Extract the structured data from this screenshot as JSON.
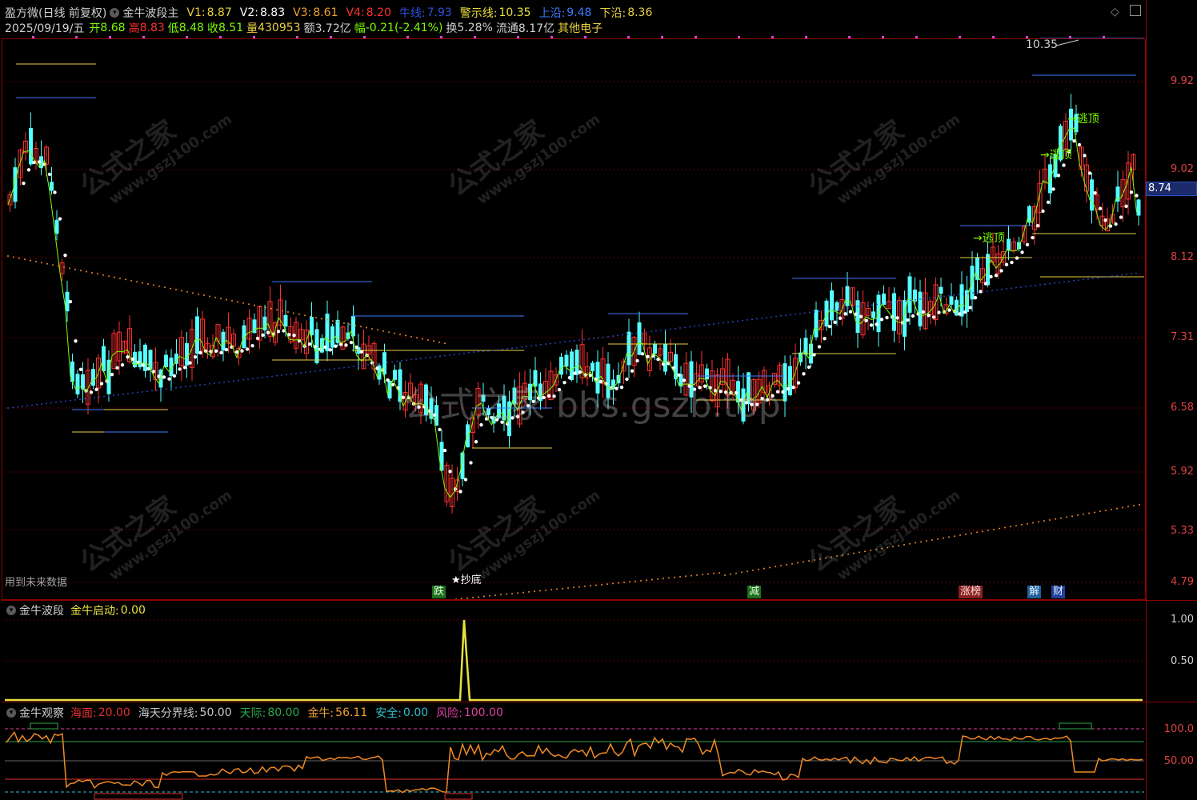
{
  "header": {
    "app_title": "盈方微(日线 前复权)",
    "indicator_name": "金牛波段主",
    "v1": {
      "label": "V1:",
      "value": "8.87"
    },
    "v2": {
      "label": "V2:",
      "value": "8.83"
    },
    "v3": {
      "label": "V3:",
      "value": "8.61"
    },
    "v4": {
      "label": "V4:",
      "value": "8.20"
    },
    "trend": {
      "label": "牛线:",
      "value": "7.93"
    },
    "warn": {
      "label": "警示线:",
      "value": "10.35"
    },
    "upper": {
      "label": "上沿:",
      "value": "9.48"
    },
    "lower": {
      "label": "下沿:",
      "value": "8.36"
    },
    "date": "2025/09/19/五",
    "open": {
      "label": "开",
      "value": "8.68"
    },
    "high": {
      "label": "高",
      "value": "8.83"
    },
    "low": {
      "label": "低",
      "value": "8.48"
    },
    "close": {
      "label": "收",
      "value": "8.51"
    },
    "volume": {
      "label": "量",
      "value": "430953"
    },
    "amount": {
      "label": "额",
      "value": "3.72亿"
    },
    "change": {
      "label": "幅",
      "value": "-0.21(-2.41%)"
    },
    "turnover": {
      "label": "换",
      "value": "5.28%"
    },
    "float_cap": {
      "label": "流通",
      "value": "8.17亿"
    },
    "sector": "其他电子"
  },
  "main_panel": {
    "price_axis": [
      "9.92",
      "9.02",
      "8.12",
      "7.31",
      "6.58",
      "5.92",
      "5.33",
      "4.79"
    ],
    "current_price_tag": "8.74",
    "peak_label": "10.35",
    "bottom_label": "抄底",
    "escape_labels": [
      "逃顶",
      "逃顶",
      "逃顶"
    ],
    "future_note": "用到未来数据",
    "event_tags": [
      {
        "text": "跌",
        "color": "#2e8b2e"
      },
      {
        "text": "减",
        "color": "#2e8b2e"
      },
      {
        "text": "涨榜",
        "color": "#b03030"
      },
      {
        "text": "解",
        "color": "#2a6fa8"
      },
      {
        "text": "财",
        "color": "#2a4fa8"
      }
    ]
  },
  "sub_panel_1": {
    "title": "金牛波段",
    "field": {
      "label": "金牛启动:",
      "value": "0.00"
    },
    "axis": [
      "1.00",
      "0.50"
    ]
  },
  "sub_panel_2": {
    "title": "金牛观察",
    "fields": [
      {
        "label": "海面:",
        "value": "20.00",
        "color": "#e03030"
      },
      {
        "label": "海天分界线:",
        "value": "50.00",
        "color": "#c8c8c8"
      },
      {
        "label": "天际:",
        "value": "80.00",
        "color": "#2aa84a"
      },
      {
        "label": "金牛:",
        "value": "56.11",
        "color": "#f0a030"
      },
      {
        "label": "安全:",
        "value": "0.00",
        "color": "#30c0d0"
      },
      {
        "label": "风险:",
        "value": "100.00",
        "color": "#e040a0"
      }
    ],
    "axis": [
      "100.0",
      "50.00"
    ]
  },
  "watermarks": {
    "site": "公式之家",
    "url": "www.gszj100.com",
    "center": "公式之家 bbs.gszb.top"
  },
  "colors": {
    "up": "#ff3030",
    "down": "#54ffff",
    "ma_white": "#ffffff",
    "ma_green": "#7cfc00",
    "level_blue": "#3b7cff",
    "level_yellow": "#e8d040",
    "orange": "#f08a24"
  }
}
